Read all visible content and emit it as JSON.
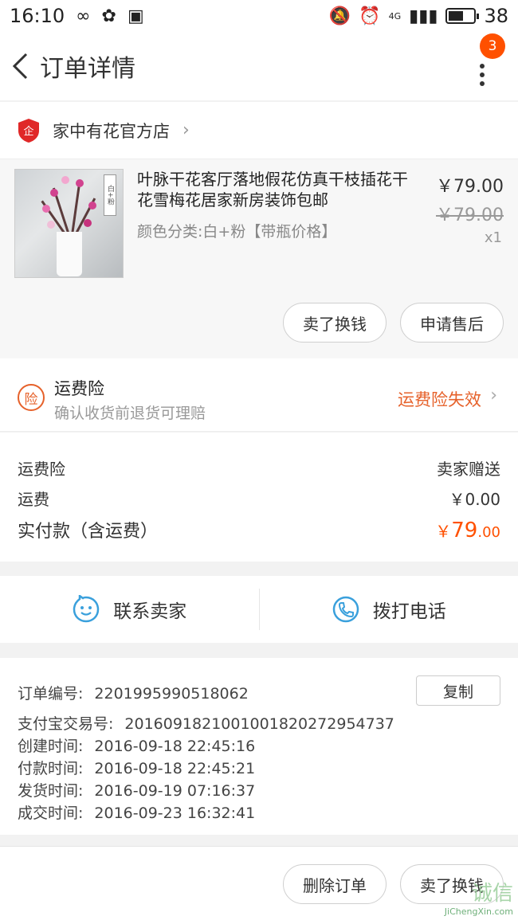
{
  "status": {
    "time": "16:10",
    "network": "4G",
    "battery": "38"
  },
  "nav": {
    "title": "订单详情",
    "badge": "3"
  },
  "shop": {
    "name": "家中有花官方店",
    "logo_text": "企"
  },
  "item": {
    "title": "叶脉干花客厅落地假花仿真干枝插花干花雪梅花居家新房装饰包邮",
    "spec": "颜色分类:白+粉【带瓶价格】",
    "price": "￥79.00",
    "original_price": "￥79.00",
    "qty": "x1",
    "thumb_tag": "白+粉",
    "actions": [
      "卖了换钱",
      "申请售后"
    ]
  },
  "insurance": {
    "icon_text": "险",
    "title": "运费险",
    "subtitle": "确认收货前退货可理赔",
    "status": "运费险失效"
  },
  "fees": {
    "rows": [
      {
        "label": "运费险",
        "value": "卖家赠送"
      },
      {
        "label": "运费",
        "value": "￥0.00"
      }
    ],
    "total_label": "实付款（含运费）",
    "total_symbol": "￥",
    "total_int": "79",
    "total_dec": ".00"
  },
  "contact": {
    "chat_label": "联系卖家",
    "call_label": "拨打电话"
  },
  "order_info": {
    "copy_label": "复制",
    "lines": [
      {
        "key": "订单编号:",
        "value": "2201995990518062"
      },
      {
        "key": "支付宝交易号:",
        "value": "2016091821001001820272954737"
      },
      {
        "key": "创建时间:",
        "value": "2016-09-18 22:45:16"
      },
      {
        "key": "付款时间:",
        "value": "2016-09-18 22:45:21"
      },
      {
        "key": "发货时间:",
        "value": "2016-09-19 07:16:37"
      },
      {
        "key": "成交时间:",
        "value": "2016-09-23 16:32:41"
      }
    ]
  },
  "bottom_actions": [
    "删除订单",
    "卖了换钱"
  ],
  "watermark": {
    "text": "诚信",
    "sub": "JiChengXin.com"
  },
  "colors": {
    "accent": "#ff5000",
    "insurance": "#e6612a",
    "contact_icon": "#3aa0dc"
  }
}
